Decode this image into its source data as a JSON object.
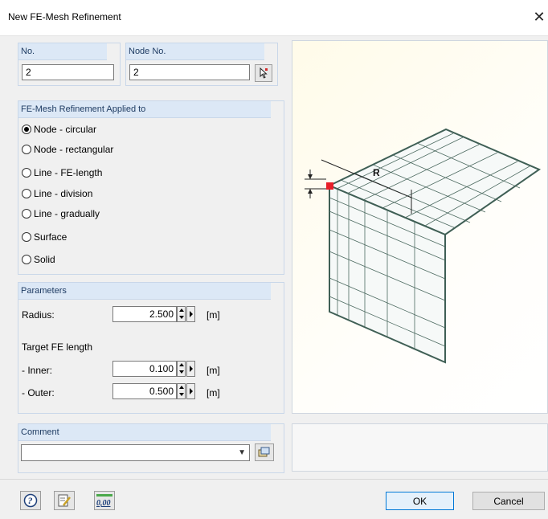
{
  "window": {
    "title": "New FE-Mesh Refinement",
    "close_glyph": "✕"
  },
  "no": {
    "label": "No.",
    "value": "2"
  },
  "node_no": {
    "label": "Node No.",
    "value": "2"
  },
  "applied_to": {
    "title": "FE-Mesh Refinement Applied to",
    "options": [
      {
        "label": "Node - circular",
        "selected": true
      },
      {
        "label": "Node - rectangular",
        "selected": false
      },
      {
        "label": "Line - FE-length",
        "selected": false
      },
      {
        "label": "Line - division",
        "selected": false
      },
      {
        "label": "Line - gradually",
        "selected": false
      },
      {
        "label": "Surface",
        "selected": false
      },
      {
        "label": "Solid",
        "selected": false
      }
    ]
  },
  "parameters": {
    "title": "Parameters",
    "radius": {
      "label": "Radius:",
      "value": "2.500",
      "unit": "[m]"
    },
    "target_label": "Target FE length",
    "inner": {
      "label": "- Inner:",
      "value": "0.100",
      "unit": "[m]"
    },
    "outer": {
      "label": "- Outer:",
      "value": "0.500",
      "unit": "[m]"
    }
  },
  "preview": {
    "label_r": "R",
    "accent_color": "#e8202a"
  },
  "comment": {
    "title": "Comment",
    "value": ""
  },
  "buttons": {
    "ok": "OK",
    "cancel": "Cancel",
    "units_icon_text": "0,00"
  }
}
